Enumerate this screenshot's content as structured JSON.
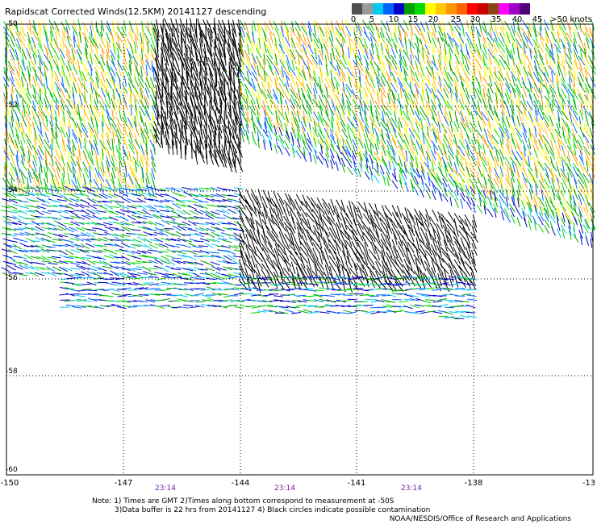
{
  "title": "Rapidscat Corrected Winds(12.5KM) 20141127 descending",
  "legend": {
    "labels": [
      "0",
      "5",
      "10",
      "15",
      "20",
      "25",
      "30",
      "35",
      "40",
      "45",
      ">50 knots"
    ],
    "colors": [
      "#505050",
      "#9a9a9a",
      "#00c8f0",
      "#0064ff",
      "#0000c8",
      "#00a000",
      "#00dc00",
      "#ffff00",
      "#ffc800",
      "#ff9600",
      "#ff6400",
      "#ff0000",
      "#c80000",
      "#8b4513",
      "#ff00ff",
      "#a000c8",
      "#500078"
    ]
  },
  "map": {
    "lat_labels": [
      "-50",
      "-52",
      "-54",
      "-56",
      "-58",
      "-60"
    ],
    "lon_labels": [
      "-150",
      "-147",
      "-144",
      "-141",
      "-138",
      "-13"
    ],
    "time_labels": [
      "23:14",
      "23:14",
      "23:14"
    ]
  },
  "notes": {
    "line1": "Note: 1) Times are GMT 2)Times along bottom correspond to measurement at -50S",
    "line2": "3)Data buffer is 22 hrs from 20141127 4) Black circles indicate possible contamination",
    "credit": "NOAA/NESDIS/Office of Research and Applications"
  }
}
